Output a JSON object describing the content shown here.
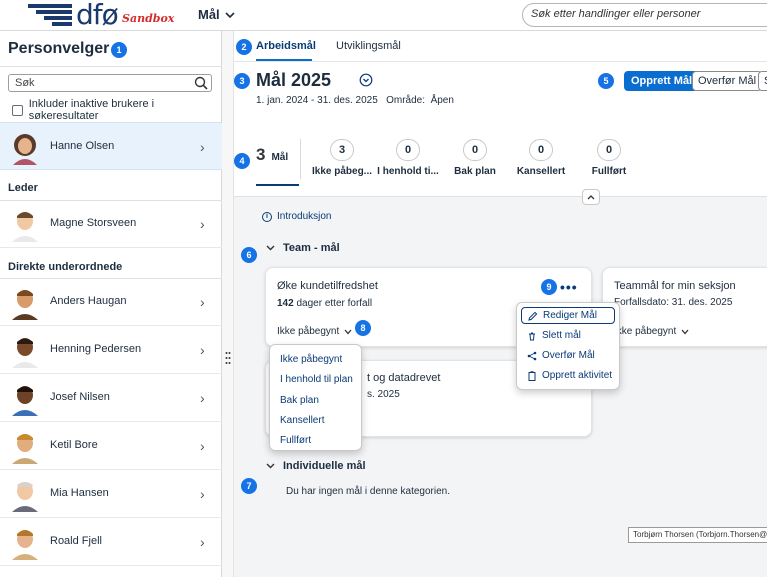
{
  "header": {
    "logo_text": "dfø",
    "logo_sandbox": "Sandbox",
    "nav_label": "Mål",
    "search_placeholder": "Søk etter handlinger eller personer"
  },
  "sidebar": {
    "title": "Personvelger",
    "search_placeholder": "Søk",
    "include_inactive_label": "Inkluder inaktive brukere i søkeresultater",
    "selected_person": "Hanne Olsen",
    "leader_heading": "Leder",
    "leader": "Magne Storsveen",
    "reports_heading": "Direkte underordnede",
    "reports": [
      "Anders Haugan",
      "Henning Pedersen",
      "Josef Nilsen",
      "Ketil Bore",
      "Mia Hansen",
      "Roald Fjell"
    ]
  },
  "main": {
    "tabs": [
      "Arbeidsmål",
      "Utviklingsmål"
    ],
    "goal_title": "Mål 2025",
    "period": "1. jan. 2024 - 31. des. 2025",
    "area_label": "Område:",
    "area_value": "Åpen",
    "buttons": {
      "create": "Opprett Mål",
      "transfer": "Overfør Mål",
      "more": "S"
    },
    "kpis": [
      {
        "count": "3",
        "label": "Mål"
      },
      {
        "count": "3",
        "label": "Ikke påbeg..."
      },
      {
        "count": "0",
        "label": "I henhold ti..."
      },
      {
        "count": "0",
        "label": "Bak plan"
      },
      {
        "count": "0",
        "label": "Kansellert"
      },
      {
        "count": "0",
        "label": "Fullført"
      }
    ],
    "intro_label": "Introduksjon",
    "team_heading": "Team - mål",
    "individual_heading": "Individuelle mål",
    "empty_text": "Du har ingen mål i denne kategorien.",
    "cards": [
      {
        "title": "Øke kundetilfredshet",
        "days_bold": "142",
        "days_rest": " dager etter forfall",
        "status": "Ikke påbegynt"
      },
      {
        "title": "Teammål for min seksjon",
        "due": "Forfallsdato: 31. des. 2025",
        "status": "Ikke påbegynt"
      },
      {
        "title": "t og datadrevet",
        "due": "s. 2025"
      }
    ],
    "status_options": [
      "Ikke påbegynt",
      "I henhold til plan",
      "Bak plan",
      "Kansellert",
      "Fullført"
    ],
    "actions": [
      "Rediger Mål",
      "Slett mål",
      "Overfør Mål",
      "Opprett aktivitet"
    ],
    "more_label": "•••",
    "tooltip": "Torbjørn Thorsen (Torbjorn.Thorsen@dfo"
  },
  "badges": [
    "1",
    "2",
    "3",
    "4",
    "5",
    "6",
    "7",
    "8",
    "9"
  ],
  "colors": {
    "accent": "#0a6ed1",
    "brand": "#1a3a6e",
    "badge": "#1673e6",
    "sandbox": "#d62b2b"
  }
}
